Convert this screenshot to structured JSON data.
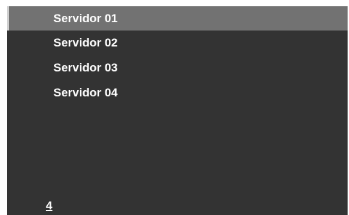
{
  "servers": {
    "items": [
      {
        "label": "Servidor 01",
        "selected": true
      },
      {
        "label": "Servidor 02",
        "selected": false
      },
      {
        "label": "Servidor 03",
        "selected": false
      },
      {
        "label": "Servidor 04",
        "selected": false
      }
    ]
  },
  "footer": {
    "count": "4"
  },
  "colors": {
    "panel_bg": "#333333",
    "selected_bg": "#727272",
    "selected_border": "#cfcfcf",
    "text": "#ffffff"
  }
}
